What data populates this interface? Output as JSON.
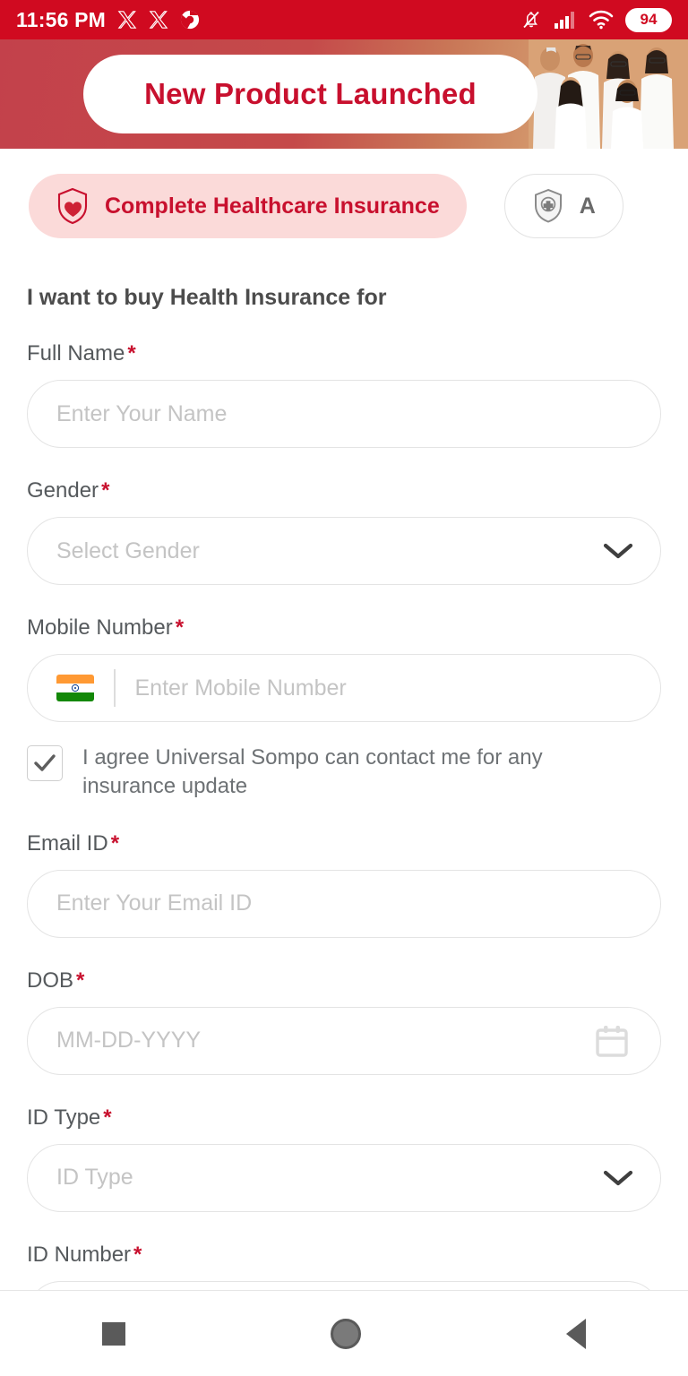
{
  "statusbar": {
    "time": "11:56 PM",
    "battery": "94",
    "icons": [
      "x-twitter-icon",
      "x-twitter-icon",
      "chrome-icon",
      "notifications-off-icon",
      "signal-bars-icon",
      "wifi-icon",
      "battery-icon"
    ]
  },
  "banner": {
    "text": "New Product Launched",
    "image_alt": "family-photo",
    "text_color": "#C8102E"
  },
  "chips": [
    {
      "label": "Complete Healthcare Insurance",
      "icon": "shield-heart-icon",
      "active": true
    },
    {
      "label": "A",
      "icon": "shield-plus-icon",
      "active": false
    }
  ],
  "form": {
    "section_title": "I want to buy Health Insurance for",
    "fields": [
      {
        "label": "Full Name",
        "required": "*",
        "placeholder": "Enter Your Name",
        "type": "text"
      },
      {
        "label": "Gender",
        "required": "*",
        "placeholder": "Select Gender",
        "type": "select"
      },
      {
        "label": "Mobile Number",
        "required": "*",
        "placeholder": "Enter Mobile Number",
        "type": "phone"
      },
      {
        "label": "Email ID",
        "required": "*",
        "placeholder": "Enter Your Email ID",
        "type": "text"
      },
      {
        "label": "DOB",
        "required": "*",
        "placeholder": "MM-DD-YYYY",
        "type": "date"
      },
      {
        "label": "ID Type",
        "required": "*",
        "placeholder": "ID Type",
        "type": "select"
      },
      {
        "label": "ID Number",
        "required": "*",
        "placeholder": "",
        "type": "text"
      }
    ],
    "consent": {
      "text": "I agree Universal Sompo can contact me for any insurance update",
      "checked": true
    }
  },
  "navbar": {
    "items": [
      "recents-square-icon",
      "home-circle-icon",
      "back-triangle-icon"
    ]
  },
  "colors": {
    "brand_red": "#C8102E",
    "status_red": "#D00A20",
    "chip_pink": "#FBDAD9",
    "border_gray": "#E4E4E4",
    "placeholder_gray": "#C4C4C4"
  }
}
